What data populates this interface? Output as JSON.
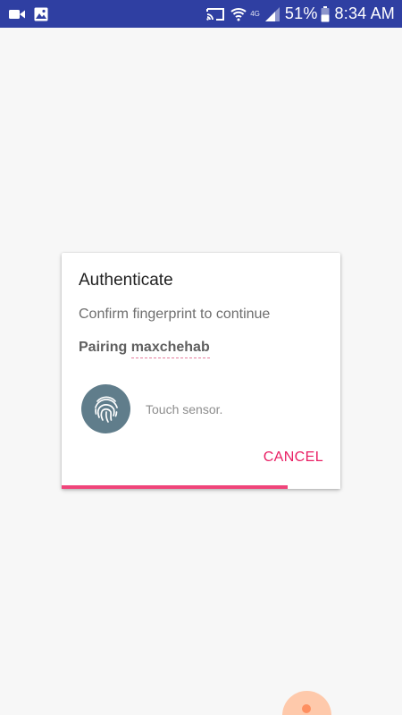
{
  "status_bar": {
    "background": "#2f3fa2",
    "left_icons": [
      "video-camera-icon",
      "image-icon"
    ],
    "right_icons": [
      "cast-icon",
      "wifi-icon",
      "cell-signal-icon",
      "battery-icon"
    ],
    "network_type": "4G",
    "battery": "51%",
    "time": "8:34 AM"
  },
  "dialog": {
    "title": "Authenticate",
    "subtitle": "Confirm fingerprint to continue",
    "description_prefix": "Pairing ",
    "username": "maxchehab",
    "sensor_hint": "Touch sensor.",
    "cancel_label": "CANCEL",
    "icon": "fingerprint-icon",
    "progress_fraction": 0.81,
    "accent_color": "#e91e63",
    "icon_circle_color": "#607d8b"
  }
}
